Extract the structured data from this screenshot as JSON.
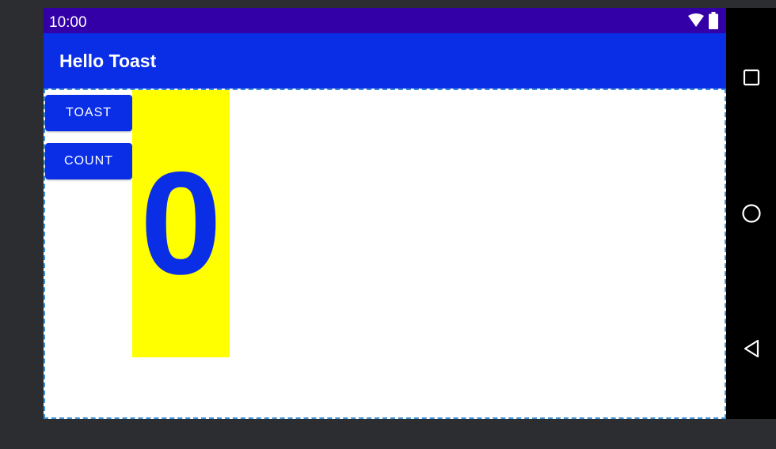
{
  "status_bar": {
    "time": "10:00",
    "icons": [
      "wifi-icon",
      "battery-icon"
    ]
  },
  "app_bar": {
    "title": "Hello Toast"
  },
  "buttons": {
    "toast_label": "TOAST",
    "count_label": "COUNT"
  },
  "counter": {
    "value": "0"
  },
  "nav_bar": {
    "icons": [
      "recents-icon",
      "home-icon",
      "back-icon"
    ]
  },
  "colors": {
    "status_bar": "#3300a8",
    "primary": "#0a2ee6",
    "count_background": "#ffff00",
    "screen_background": "#ffffff",
    "frame": "#2b2d30"
  }
}
